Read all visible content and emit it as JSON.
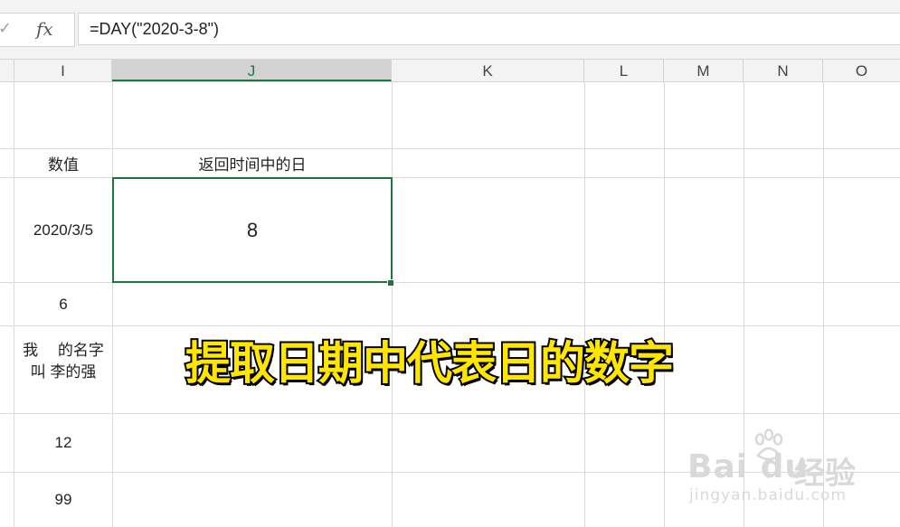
{
  "formula_bar": {
    "check_glyph": "✓",
    "fx_label": "fx",
    "formula": "=DAY(\"2020-3-8\")"
  },
  "columns": {
    "I": "I",
    "J": "J",
    "K": "K",
    "L": "L",
    "M": "M",
    "N": "N",
    "O": "O"
  },
  "cells": {
    "header_value": "数值",
    "header_result": "返回时间中的日",
    "date_value": "2020/3/5",
    "result_value": "8",
    "number_six": "6",
    "text_line1": "我　 的名字",
    "text_line2": "叫  李的强",
    "number_twelve": "12",
    "number_ninety_nine": "99"
  },
  "overlay": {
    "caption": "提取日期中代表日的数字"
  },
  "watermark": {
    "logo": "Bai du",
    "jingyan": "经验",
    "url": "jingyan.baidu.com"
  },
  "colors": {
    "accent_green": "#217346",
    "caption_yellow": "#ffe600",
    "caption_outline": "#000000"
  }
}
